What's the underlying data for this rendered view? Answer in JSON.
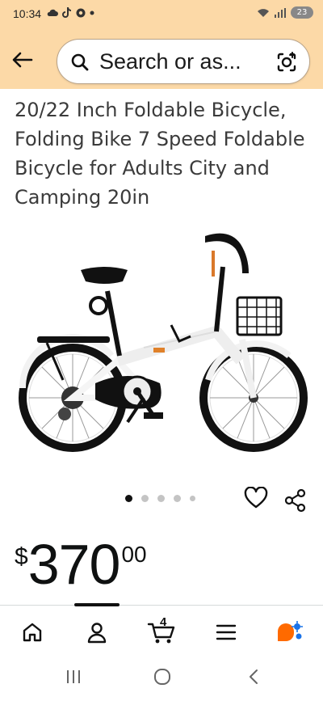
{
  "status_bar": {
    "time": "10:34",
    "battery": "23"
  },
  "header": {
    "search_text": "Search or as..."
  },
  "product": {
    "title": "20/22 Inch Foldable Bicycle, Folding Bike 7 Speed Foldable Bicycle for Adults City and Camping 20in",
    "price_symbol": "$",
    "price_whole": "370",
    "price_fraction": "00"
  },
  "carousel": {
    "total_dots": 5,
    "active_index": 0
  },
  "bottom_nav": {
    "cart_count": "4"
  },
  "colors": {
    "header_bg": "#fcd9a7",
    "text": "#0f1111",
    "rufus_orange": "#ff6a00",
    "rufus_blue": "#1a73e8"
  },
  "icons": [
    "back-arrow-icon",
    "search-icon",
    "camera-lens-icon",
    "heart-icon",
    "share-icon",
    "home-icon",
    "account-icon",
    "cart-icon",
    "menu-icon",
    "rufus-icon"
  ]
}
